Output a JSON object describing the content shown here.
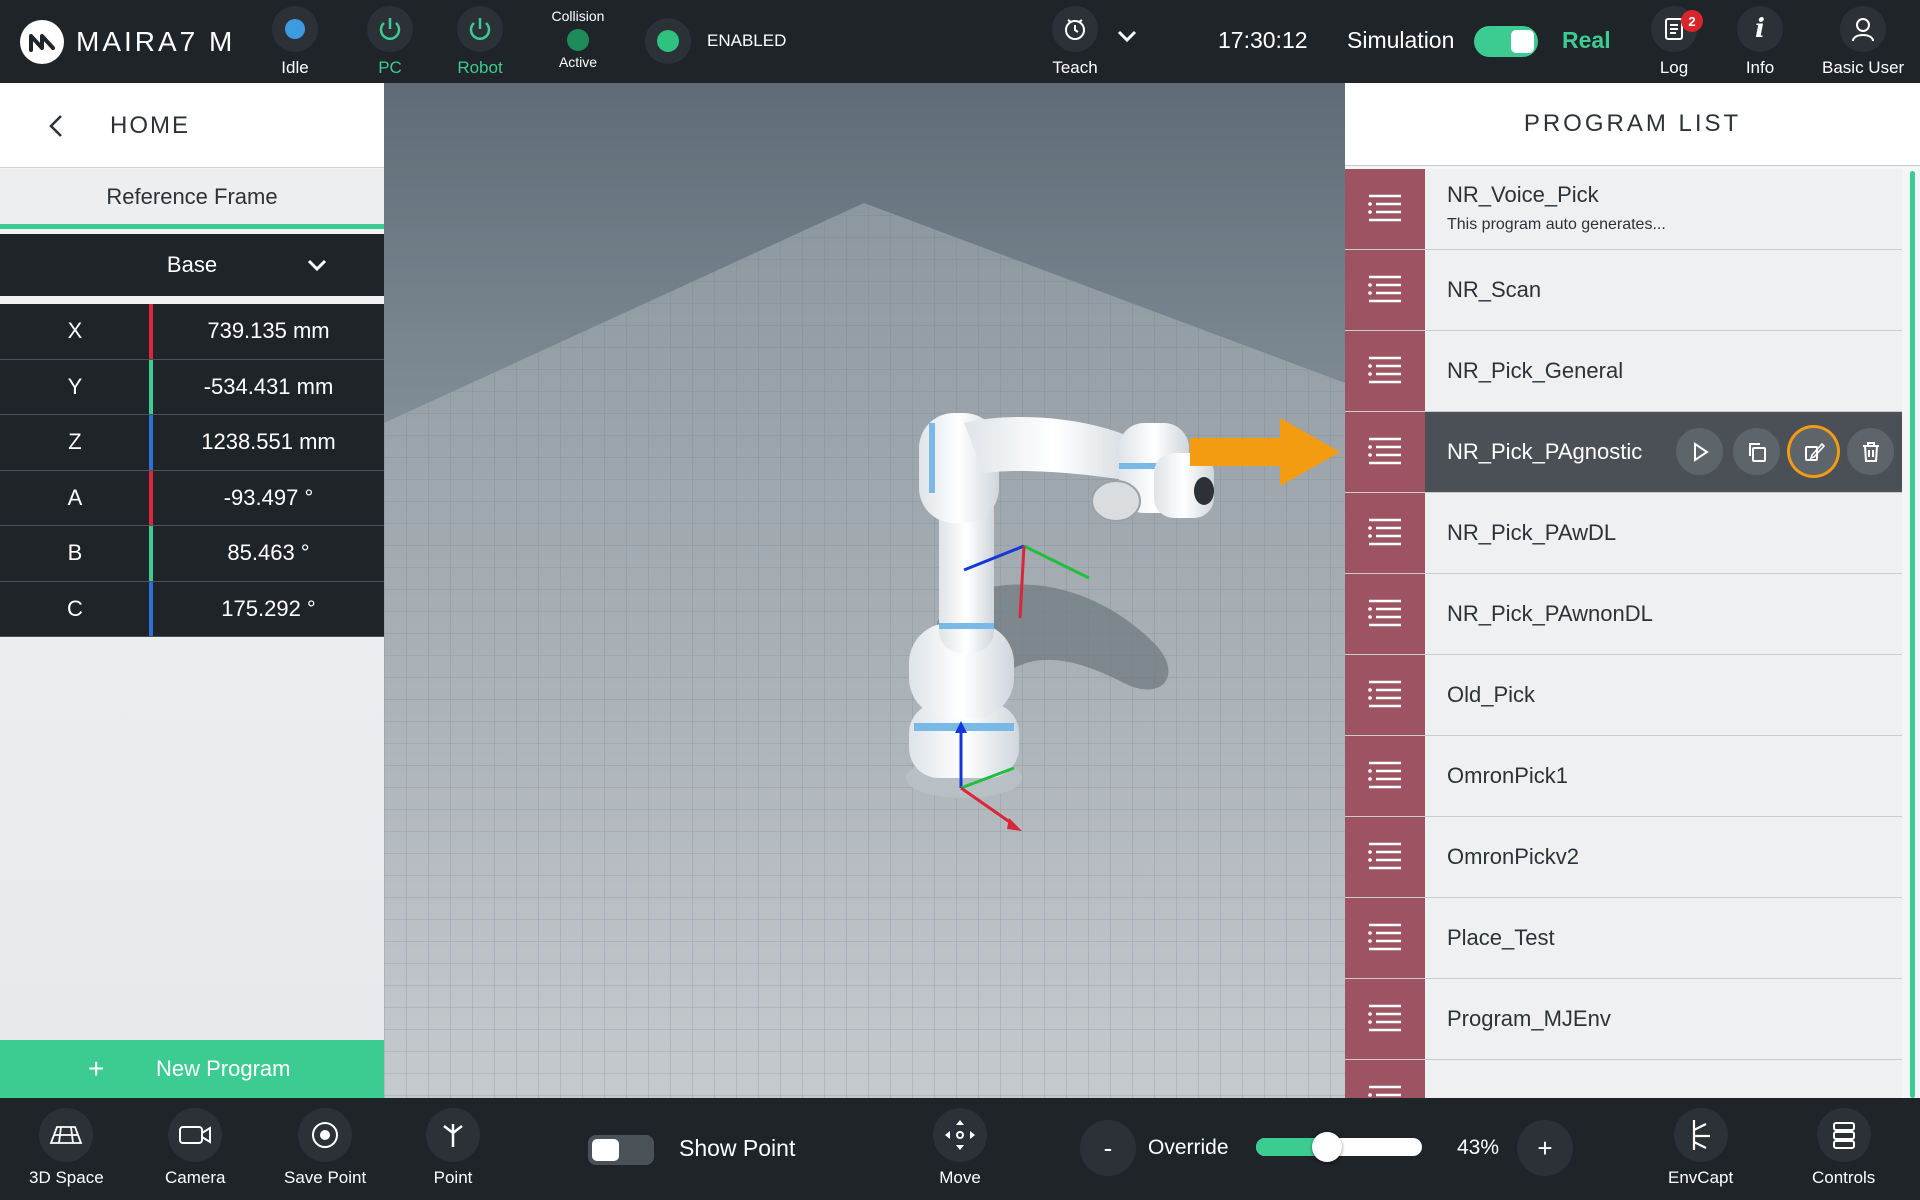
{
  "topbar": {
    "brand": "MAIRA7 M",
    "status_items": [
      {
        "label": "Idle",
        "icon": "status-dot-icon",
        "color": "#ffffff"
      },
      {
        "label": "PC",
        "icon": "power-cycle-icon",
        "color": "#3ccb91"
      },
      {
        "label": "Robot",
        "icon": "power-icon",
        "color": "#3ccb91"
      }
    ],
    "collision": {
      "title": "Collision",
      "status": "Active"
    },
    "enabled_label": "ENABLED",
    "mode": {
      "label": "Teach",
      "icon": "teach-icon"
    },
    "clock": "17:30:12",
    "simulation_label": "Simulation",
    "real_label": "Real",
    "log": {
      "label": "Log",
      "badge": "2"
    },
    "info_label": "Info",
    "user_label": "Basic User"
  },
  "left": {
    "title": "HOME",
    "reference_frame_label": "Reference Frame",
    "reference_frame_value": "Base",
    "coords": [
      {
        "key": "X",
        "value": "739.135 mm",
        "color": "#d9263a"
      },
      {
        "key": "Y",
        "value": "-534.431 mm",
        "color": "#3ccb91"
      },
      {
        "key": "Z",
        "value": "1238.551 mm",
        "color": "#2d6fd6"
      },
      {
        "key": "A",
        "value": "-93.497 °",
        "color": "#d9263a"
      },
      {
        "key": "B",
        "value": "85.463 °",
        "color": "#3ccb91"
      },
      {
        "key": "C",
        "value": "175.292 °",
        "color": "#2d6fd6"
      }
    ],
    "new_program_plus": "+",
    "new_program_label": "New Program"
  },
  "program_list": {
    "title": "PROGRAM LIST",
    "items": [
      {
        "name": "NR_Voice_Pick",
        "desc": "This program auto generates..."
      },
      {
        "name": "NR_Scan",
        "desc": ""
      },
      {
        "name": "NR_Pick_General",
        "desc": ""
      },
      {
        "name": "NR_Pick_PAgnostic",
        "desc": "",
        "selected": true
      },
      {
        "name": "NR_Pick_PAwDL",
        "desc": ""
      },
      {
        "name": "NR_Pick_PAwnonDL",
        "desc": ""
      },
      {
        "name": "Old_Pick",
        "desc": ""
      },
      {
        "name": "OmronPick1",
        "desc": ""
      },
      {
        "name": "OmronPickv2",
        "desc": ""
      },
      {
        "name": "Place_Test",
        "desc": ""
      },
      {
        "name": "Program_MJEnv",
        "desc": ""
      },
      {
        "name": "",
        "desc": ""
      }
    ],
    "row_actions": [
      "play-icon",
      "copy-icon",
      "edit-icon",
      "trash-icon"
    ]
  },
  "bottombar": {
    "items_left": [
      {
        "label": "3D Space",
        "icon": "3d-space-icon"
      },
      {
        "label": "Camera",
        "icon": "camera-icon"
      },
      {
        "label": "Save Point",
        "icon": "save-point-icon"
      },
      {
        "label": "Point",
        "icon": "point-icon"
      }
    ],
    "show_point_label": "Show Point",
    "move_label": "Move",
    "override_minus": "-",
    "override_label": "Override",
    "override_value_pct": 43,
    "override_display": "43%",
    "override_plus": "+",
    "items_right": [
      {
        "label": "EnvCapt",
        "icon": "env-capture-icon"
      },
      {
        "label": "Controls",
        "icon": "controls-icon"
      }
    ]
  },
  "colors": {
    "accent": "#3ccb91",
    "program_icon_bg": "#9e5363",
    "highlight": "#f39c12",
    "dark_bar": "#1f2429"
  }
}
